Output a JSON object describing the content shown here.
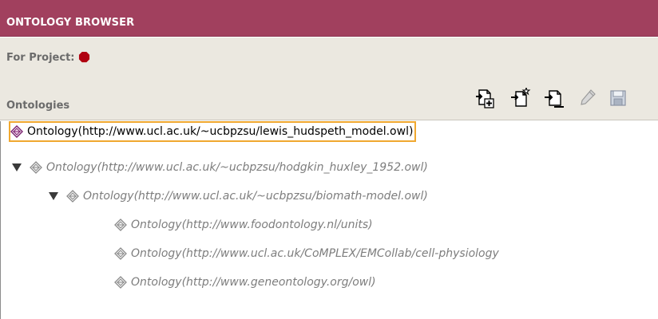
{
  "header": {
    "title": "ONTOLOGY BROWSER"
  },
  "project": {
    "label": "For Project:",
    "status_color": "#b00010"
  },
  "section": {
    "label": "Ontologies"
  },
  "toolbar": {
    "icons": [
      "add-ontology-icon",
      "create-ontology-icon",
      "import-ontology-icon",
      "edit-icon",
      "save-icon"
    ]
  },
  "tree": {
    "nodes": [
      {
        "label": "Ontology(http://www.ucl.ac.uk/~ucbpzsu/lewis_hudspeth_model.owl)",
        "selected": true,
        "imported": false,
        "expanded": null
      },
      {
        "label": "Ontology(http://www.ucl.ac.uk/~ucbpzsu/hodgkin_huxley_1952.owl)",
        "selected": false,
        "imported": true,
        "expanded": true
      },
      {
        "label": "Ontology(http://www.ucl.ac.uk/~ucbpzsu/biomath-model.owl)",
        "selected": false,
        "imported": true,
        "expanded": true
      },
      {
        "label": "Ontology(http://www.foodontology.nl/units)",
        "selected": false,
        "imported": true,
        "expanded": null
      },
      {
        "label": "Ontology(http://www.ucl.ac.uk/CoMPLEX/EMCollab/cell-physiology",
        "selected": false,
        "imported": true,
        "expanded": null
      },
      {
        "label": "Ontology(http://www.geneontology.org/owl)",
        "selected": false,
        "imported": true,
        "expanded": null
      }
    ]
  },
  "colors": {
    "header_bg": "#a1405e",
    "panel_bg": "#ebe8e0",
    "selection_border": "#f0a830",
    "imported_text": "#7d7d7d"
  }
}
